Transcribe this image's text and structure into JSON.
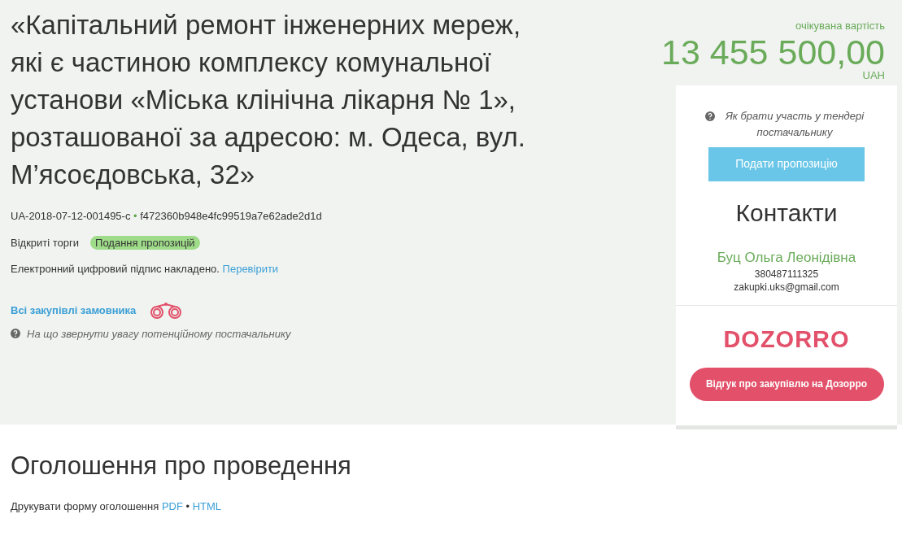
{
  "title": "«Капітальний ремонт інженерних мереж, які є частиною комплексу комунальної установи «Міська клінічна лікарня № 1», розташованої за адресою: м. Одеса, вул. М’ясоєдовська, 32»",
  "tender_id": "UA-2018-07-12-001495-c",
  "id_separator": "•",
  "hash": "f472360b948e4fc99519a7e62ade2d1d",
  "procedure": "Відкриті торги",
  "status_badge": "Подання пропозицій",
  "signature": {
    "text": "Електронний цифровий підпис накладено.",
    "link": "Перевірити"
  },
  "customer_link": "Всі закупівлі замовника",
  "hint": "На що звернути увагу потенційному постачальнику",
  "price": {
    "label": "очікувана вартість",
    "amount": "13 455 500,00",
    "currency": "UAH"
  },
  "sidebar": {
    "help_link": "Як брати участь у тендері постачальнику",
    "submit_button": "Подати пропозицію",
    "contacts_heading": "Контакти",
    "contact_name": "Буц Ольга Леонідівна",
    "phone": "380487111325",
    "email": "zakupki.uks@gmail.com",
    "logo": "DOZORRO",
    "feedback_button": "Відгук про закупівлю на Дозорро"
  },
  "announcement": {
    "heading": "Оголошення про проведення",
    "print_label": "Друкувати форму оголошення",
    "links": [
      {
        "text": "PDF"
      },
      {
        "text": "HTML"
      }
    ],
    "separator": "•"
  }
}
